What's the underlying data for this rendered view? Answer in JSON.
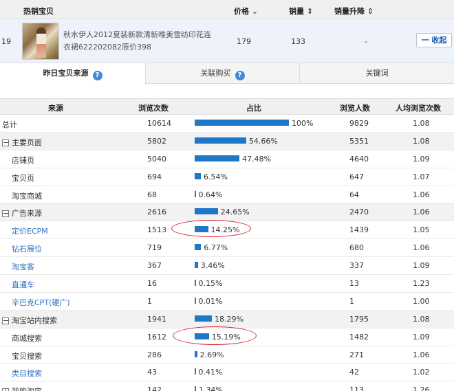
{
  "hot_table": {
    "headers": {
      "title": "热销宝贝",
      "price": "价格",
      "sales": "销量",
      "trend": "销量升降"
    },
    "sort_down_glyph": "⌄",
    "sort_glyph": "⇕",
    "row": {
      "rank": "19",
      "title": "秋水伊人2012夏装新款清新唯美雪纺印花连衣裙622202082原价398",
      "price": "179",
      "sales": "133",
      "trend": "-",
      "collapse_label": "一 收起"
    }
  },
  "tabs": [
    {
      "label": "昨日宝贝来源",
      "active": true
    },
    {
      "label": "关联购买",
      "active": false
    },
    {
      "label": "关键词",
      "active": false
    }
  ],
  "help_glyph": "?",
  "source_table": {
    "headers": {
      "name": "来源",
      "views": "浏览次数",
      "ratio": "占比",
      "users": "浏览人数",
      "avg": "人均浏览次数"
    },
    "rows": [
      {
        "name": "总计",
        "views": "10614",
        "pct": 100,
        "pct_label": "100%",
        "users": "9829",
        "avg": "1.08",
        "group": false,
        "toggle": "",
        "indent": false,
        "link": false
      },
      {
        "name": "主要页面",
        "views": "5802",
        "pct": 54.66,
        "pct_label": "54.66%",
        "users": "5351",
        "avg": "1.08",
        "group": true,
        "toggle": "−",
        "indent": false,
        "link": false
      },
      {
        "name": "店铺页",
        "views": "5040",
        "pct": 47.48,
        "pct_label": "47.48%",
        "users": "4640",
        "avg": "1.09",
        "group": false,
        "toggle": "",
        "indent": true,
        "link": false
      },
      {
        "name": "宝贝页",
        "views": "694",
        "pct": 6.54,
        "pct_label": "6.54%",
        "users": "647",
        "avg": "1.07",
        "group": false,
        "toggle": "",
        "indent": true,
        "link": false
      },
      {
        "name": "淘宝商城",
        "views": "68",
        "pct": 0.64,
        "pct_label": "0.64%",
        "users": "64",
        "avg": "1.06",
        "group": false,
        "toggle": "",
        "indent": true,
        "link": false
      },
      {
        "name": "广告来源",
        "views": "2616",
        "pct": 24.65,
        "pct_label": "24.65%",
        "users": "2470",
        "avg": "1.06",
        "group": true,
        "toggle": "−",
        "indent": false,
        "link": false
      },
      {
        "name": "定价ECPM",
        "views": "1513",
        "pct": 14.25,
        "pct_label": "14.25%",
        "users": "1439",
        "avg": "1.05",
        "group": false,
        "toggle": "",
        "indent": true,
        "link": true
      },
      {
        "name": "钻石展位",
        "views": "719",
        "pct": 6.77,
        "pct_label": "6.77%",
        "users": "680",
        "avg": "1.06",
        "group": false,
        "toggle": "",
        "indent": true,
        "link": true
      },
      {
        "name": "淘宝客",
        "views": "367",
        "pct": 3.46,
        "pct_label": "3.46%",
        "users": "337",
        "avg": "1.09",
        "group": false,
        "toggle": "",
        "indent": true,
        "link": true
      },
      {
        "name": "直通车",
        "views": "16",
        "pct": 0.15,
        "pct_label": "0.15%",
        "users": "13",
        "avg": "1.23",
        "group": false,
        "toggle": "",
        "indent": true,
        "link": true
      },
      {
        "name": "辛巴克CPT(硬广)",
        "views": "1",
        "pct": 0.01,
        "pct_label": "0.01%",
        "users": "1",
        "avg": "1.00",
        "group": false,
        "toggle": "",
        "indent": true,
        "link": true
      },
      {
        "name": "淘宝站内搜索",
        "views": "1941",
        "pct": 18.29,
        "pct_label": "18.29%",
        "users": "1795",
        "avg": "1.08",
        "group": true,
        "toggle": "−",
        "indent": false,
        "link": false
      },
      {
        "name": "商城搜索",
        "views": "1612",
        "pct": 15.19,
        "pct_label": "15.19%",
        "users": "1482",
        "avg": "1.09",
        "group": false,
        "toggle": "",
        "indent": true,
        "link": false
      },
      {
        "name": "宝贝搜索",
        "views": "286",
        "pct": 2.69,
        "pct_label": "2.69%",
        "users": "271",
        "avg": "1.06",
        "group": false,
        "toggle": "",
        "indent": true,
        "link": false
      },
      {
        "name": "类目搜索",
        "views": "43",
        "pct": 0.41,
        "pct_label": "0.41%",
        "users": "42",
        "avg": "1.02",
        "group": false,
        "toggle": "",
        "indent": true,
        "link": true
      },
      {
        "name": "我的淘宝",
        "views": "142",
        "pct": 1.34,
        "pct_label": "1.34%",
        "users": "113",
        "avg": "1.26",
        "group": false,
        "toggle": "+",
        "indent": false,
        "link": false
      }
    ]
  },
  "colors": {
    "bar": "#1f77c8",
    "link": "#2b6fc2",
    "highlight_circle": "#d9272e"
  }
}
